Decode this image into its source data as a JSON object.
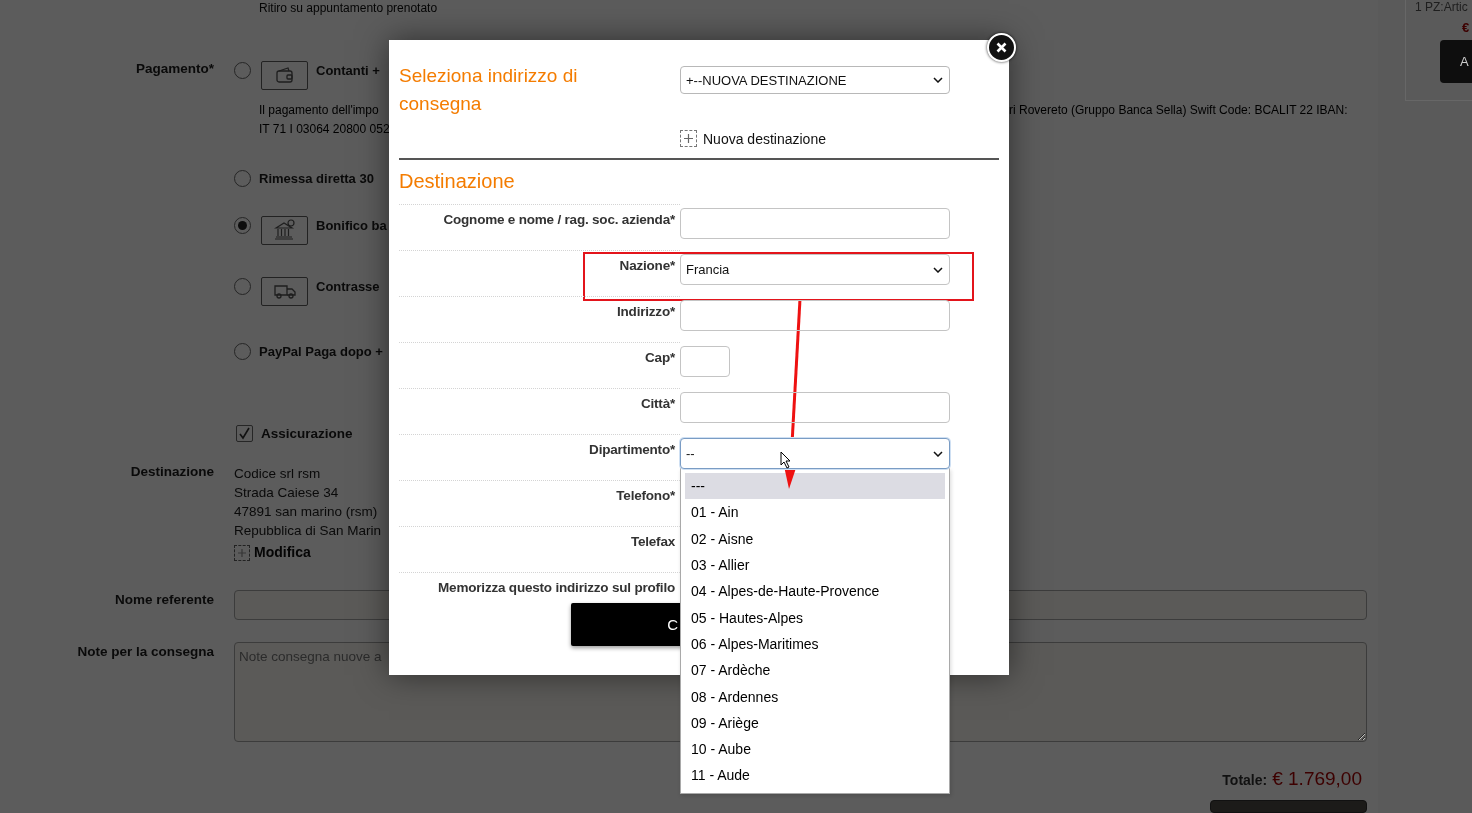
{
  "background": {
    "top_note": "Ritiro su appuntamento prenotato",
    "payment": {
      "label": "Pagamento*",
      "options": [
        {
          "kind": "wallet",
          "label": "Contanti +",
          "selected": false,
          "details": [
            "Il pagamento dell'impo",
            "IT 71 I 03064 20800 052"
          ],
          "details_continued": "ri Rovereto (Gruppo Banca Sella) Swift Code: BCALIT 22 IBAN:"
        },
        {
          "kind": "plain",
          "label": "Rimessa diretta 30",
          "selected": false
        },
        {
          "kind": "bank",
          "label": "Bonifico ba",
          "selected": true
        },
        {
          "kind": "van",
          "label": "Contrasse",
          "selected": false
        },
        {
          "kind": "plain",
          "label": "PayPal Paga dopo +",
          "selected": false
        }
      ]
    },
    "insurance": {
      "label": "Assicurazione",
      "checked": true
    },
    "destination": {
      "label": "Destinazione",
      "lines": [
        "Codice srl rsm",
        "Strada Caiese 34",
        "47891 san marino (rsm)",
        "Repubblica di San Marin"
      ],
      "edit_link": "Modifica"
    },
    "contact": {
      "label": "Nome referente"
    },
    "notes": {
      "label": "Note per la consegna",
      "placeholder": "Note consegna nuove a"
    },
    "total": {
      "label": "Totale:",
      "amount": "€ 1.769,00"
    },
    "cart": {
      "item": "1 PZ:Artic",
      "price": "€",
      "button": "A"
    }
  },
  "modal": {
    "title": "Seleziona indirizzo di consegna",
    "address_select": {
      "value": "+--NUOVA DESTINAZIONE"
    },
    "new_link": "Nuova destinazione",
    "section": "Destinazione",
    "fields": [
      {
        "kind": "text",
        "label": "Cognome e nome / rag. soc. azienda*",
        "highlighted": false
      },
      {
        "kind": "select",
        "label": "Nazione*",
        "value": "Francia",
        "highlighted": true,
        "focused": false
      },
      {
        "kind": "text",
        "label": "Indirizzo*",
        "highlighted": false
      },
      {
        "kind": "short",
        "label": "Cap*",
        "highlighted": false
      },
      {
        "kind": "text",
        "label": "Città*",
        "highlighted": false
      },
      {
        "kind": "select",
        "label": "Dipartimento*",
        "value": "--",
        "highlighted": false,
        "focused": true
      },
      {
        "kind": "covered",
        "label": "Telefono*",
        "highlighted": false
      },
      {
        "kind": "covered",
        "label": "Telefax",
        "highlighted": false
      },
      {
        "kind": "covered",
        "label": "Memorizza questo indirizzo sul profilo",
        "highlighted": false
      }
    ],
    "button": "C",
    "dropdown": {
      "options": [
        {
          "label": "---",
          "selected": true
        },
        {
          "label": "01 - Ain",
          "selected": false
        },
        {
          "label": "02 - Aisne",
          "selected": false
        },
        {
          "label": "03 - Allier",
          "selected": false
        },
        {
          "label": "04 - Alpes-de-Haute-Provence",
          "selected": false
        },
        {
          "label": "05 - Hautes-Alpes",
          "selected": false
        },
        {
          "label": "06 - Alpes-Maritimes",
          "selected": false
        },
        {
          "label": "07 - Ardèche",
          "selected": false
        },
        {
          "label": "08 - Ardennes",
          "selected": false
        },
        {
          "label": "09 - Ariège",
          "selected": false
        },
        {
          "label": "10 - Aube",
          "selected": false
        },
        {
          "label": "11 - Aude",
          "selected": false
        }
      ]
    }
  }
}
